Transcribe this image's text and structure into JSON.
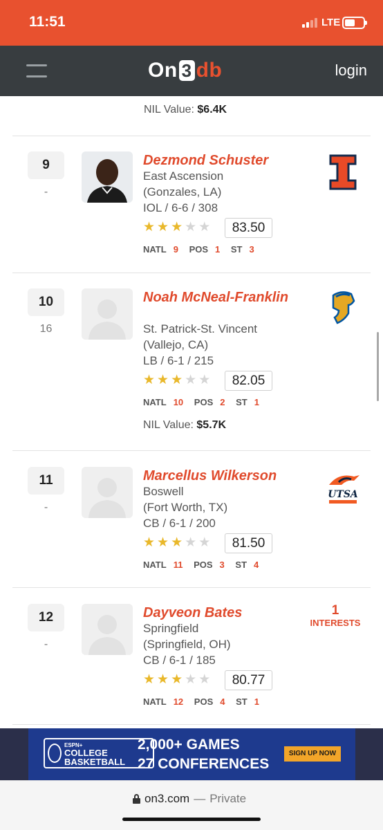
{
  "status_bar": {
    "time": "11:51",
    "network": "LTE"
  },
  "nav": {
    "logo_on": "On",
    "logo_3": "3",
    "logo_db": "db",
    "login": "login"
  },
  "top_nil": {
    "label": "NIL Value:",
    "value": "$6.4K"
  },
  "players": [
    {
      "rank": "9",
      "prev_rank": "-",
      "name": "Dezmond Schuster",
      "school": "East Ascension",
      "hometown": "(Gonzales, LA)",
      "position_size": "IOL / 6-6 / 308",
      "stars": 3,
      "rating": "83.50",
      "natl_label": "NATL",
      "natl": "9",
      "pos_label": "POS",
      "pos": "1",
      "st_label": "ST",
      "st": "3",
      "school_logo": "illinois-logo",
      "has_photo": true
    },
    {
      "rank": "10",
      "prev_rank": "16",
      "name": "Noah McNeal-Franklin",
      "school": "St. Patrick-St. Vincent",
      "hometown": "(Vallejo, CA)",
      "position_size": "LB / 6-1 / 215",
      "stars": 3,
      "rating": "82.05",
      "natl_label": "NATL",
      "natl": "10",
      "pos_label": "POS",
      "pos": "2",
      "st_label": "ST",
      "st": "1",
      "nil_label": "NIL Value:",
      "nil_value": "$5.7K",
      "school_logo": "san-jose-state-logo",
      "has_photo": false
    },
    {
      "rank": "11",
      "prev_rank": "-",
      "name": "Marcellus Wilkerson",
      "school": "Boswell",
      "hometown": "(Fort Worth, TX)",
      "position_size": "CB / 6-1 / 200",
      "stars": 3,
      "rating": "81.50",
      "natl_label": "NATL",
      "natl": "11",
      "pos_label": "POS",
      "pos": "3",
      "st_label": "ST",
      "st": "4",
      "school_logo": "utsa-logo",
      "school_logo_text": "UTSA",
      "has_photo": false
    },
    {
      "rank": "12",
      "prev_rank": "-",
      "name": "Dayveon Bates",
      "school": "Springfield",
      "hometown": "(Springfield, OH)",
      "position_size": "CB / 6-1 / 185",
      "stars": 3,
      "rating": "80.77",
      "natl_label": "NATL",
      "natl": "12",
      "pos_label": "POS",
      "pos": "4",
      "st_label": "ST",
      "st": "1",
      "interests_count": "1",
      "interests_label": "INTERESTS",
      "has_photo": false
    }
  ],
  "ad": {
    "brand": "ESPN+",
    "badge_line1": "COLLEGE",
    "badge_line2": "BASKETBALL",
    "headline1": "2,000+ GAMES",
    "headline2": "27 CONFERENCES",
    "cta": "SIGN UP NOW"
  },
  "browser": {
    "url": "on3.com",
    "separator": "—",
    "mode": "Private"
  },
  "colors": {
    "status_bar": "#e8512f",
    "nav": "#383d40",
    "accent": "#e04a2c",
    "star": "#e9b82b"
  }
}
